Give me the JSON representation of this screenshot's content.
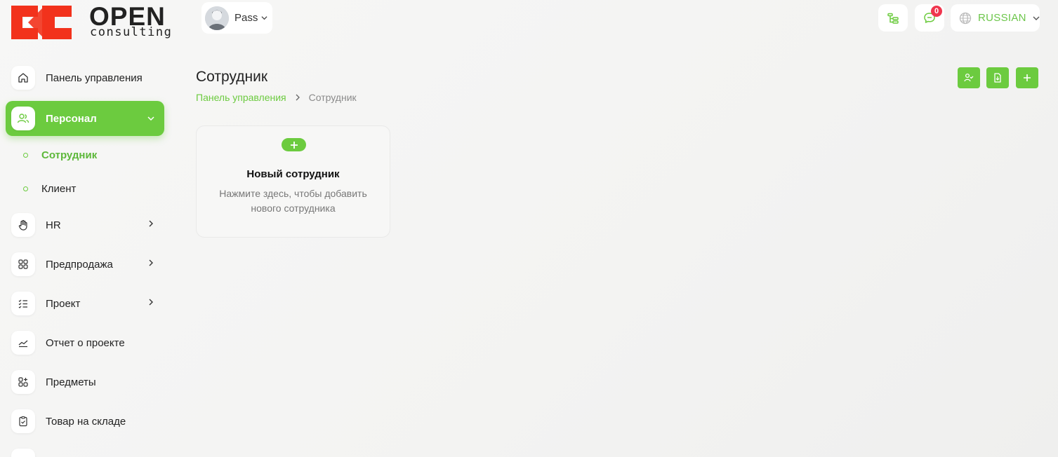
{
  "brand": {
    "name": "OPEN",
    "tagline": "consulting",
    "accent": "#6ccb3f",
    "logo_color": "#f2321c"
  },
  "header": {
    "user": {
      "name": "Pass"
    },
    "notifications_count": "0",
    "language": "RUSSIAN"
  },
  "sidebar": {
    "items": [
      {
        "label": "Панель управления",
        "icon": "home-icon"
      },
      {
        "label": "Персонал",
        "icon": "users-icon",
        "active": true
      },
      {
        "label": "HR",
        "icon": "hand-icon"
      },
      {
        "label": "Предпродажа",
        "icon": "grid-icon"
      },
      {
        "label": "Проект",
        "icon": "checklist-icon"
      },
      {
        "label": "Отчет о проекте",
        "icon": "chart-line-icon"
      },
      {
        "label": "Предметы",
        "icon": "grid-plus-icon"
      },
      {
        "label": "Товар на складе",
        "icon": "clipboard-check-icon"
      }
    ],
    "subitems": [
      {
        "label": "Сотрудник"
      },
      {
        "label": "Клиент"
      }
    ]
  },
  "page": {
    "title": "Сотрудник",
    "breadcrumb": {
      "home": "Панель управления",
      "current": "Сотрудник"
    }
  },
  "card": {
    "title": "Новый сотрудник",
    "description": "Нажмите здесь, чтобы добавить нового сотрудника"
  }
}
